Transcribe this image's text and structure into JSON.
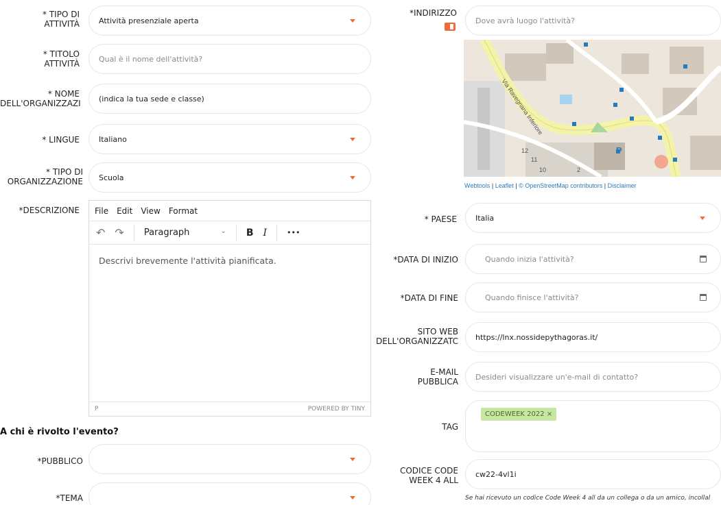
{
  "left": {
    "tipo_label": "* TIPO DI\nATTIVITÀ",
    "tipo_value": "Attività presenziale aperta",
    "titolo_label": "* TITOLO\nATTIVITÀ",
    "titolo_placeholder": "Qual è il nome dell'attività?",
    "nome_label": "* NOME\nDELL'ORGANIZZAZI",
    "nome_value": "(indica la tua sede e classe)",
    "lingue_label": "* LINGUE",
    "lingue_value": "Italiano",
    "tipo_org_label": "* TIPO DI\nORGANIZZAZIONE",
    "tipo_org_value": "Scuola",
    "descrizione_label": "*DESCRIZIONE",
    "pubblico_label": "*PUBBLICO",
    "tema_label": "*TEMA"
  },
  "editor": {
    "menu": [
      "File",
      "Edit",
      "View",
      "Format"
    ],
    "undo": "↶",
    "redo": "↷",
    "paragraph": "Paragraph",
    "bold": "B",
    "italic": "I",
    "more": "•••",
    "placeholder": "Descrivi brevemente l'attività pianificata.",
    "status_left": "P",
    "status_right": "POWERED BY TINY"
  },
  "section_heading": "A chi è rivolto l'evento?",
  "right": {
    "indirizzo_label": "*INDIRIZZO",
    "indirizzo_placeholder": "Dove avrà luogo l'attività?",
    "attribution": {
      "webtools": "Webtools",
      "leaflet": "Leaflet",
      "osm": "© OpenStreetMap contributors",
      "disclaimer": "Disclaimer",
      "sep": " | "
    },
    "paese_label": "* PAESE",
    "paese_value": "Italia",
    "data_inizio_label": "*DATA DI INIZIO",
    "data_inizio_placeholder": "Quando inizia l'attività?",
    "data_fine_label": "*DATA DI FINE",
    "data_fine_placeholder": "Quando finisce l'attività?",
    "sito_label": "SITO WEB\nDELL'ORGANIZZATC",
    "sito_value": "https://lnx.nossidepythagoras.it/",
    "email_label": "E-MAIL\nPUBBLICA",
    "email_placeholder": "Desideri visualizzare un'e-mail di contatto?",
    "tag_label": "TAG",
    "tag_value": "CODEWEEK 2022 ×",
    "codice_label": "CODICE CODE\nWEEK 4 ALL",
    "codice_value": "cw22-4vl1i",
    "codice_note": "Se hai ricevuto un codice Code Week 4 all da un collega o da un amico, incollal"
  },
  "map": {
    "street_label": "Via Ravegnana Inferiore",
    "parking_label": "P",
    "house_numbers": [
      "12",
      "11",
      "10",
      "2"
    ]
  },
  "colors": {
    "accent": "#f26a3a",
    "tag_bg": "#c6e6a4",
    "road": "#f4f4a8",
    "map_bg": "#ece6dc"
  }
}
